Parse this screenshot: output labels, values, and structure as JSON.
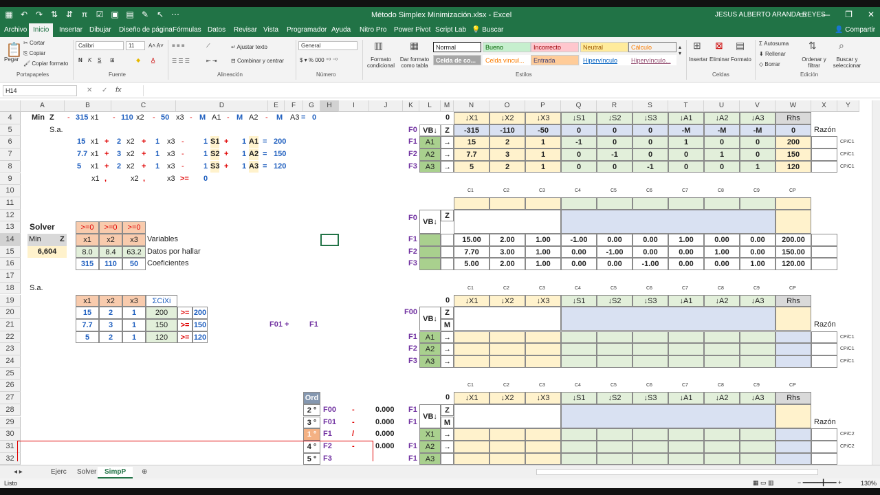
{
  "title_bar": {
    "doc_title": "Método Simplex Minimización.xlsx  -  Excel",
    "user": "JESUS ALBERTO ARANDA REYES"
  },
  "menu": [
    "Archivo",
    "Inicio",
    "Insertar",
    "Dibujar",
    "Diseño de página",
    "Fórmulas",
    "Datos",
    "Revisar",
    "Vista",
    "Programador",
    "Ayuda",
    "Nitro Pro",
    "Power Pivot",
    "Script Lab",
    "Buscar",
    "Compartir"
  ],
  "ribbon": {
    "clipboard": {
      "paste": "Pegar",
      "cut": "Cortar",
      "copy": "Copiar",
      "format_painter": "Copiar formato",
      "label": "Portapapeles"
    },
    "font": {
      "name": "Calibri",
      "size": "11",
      "label": "Fuente"
    },
    "alignment": {
      "wrap": "Ajustar texto",
      "merge": "Combinar y centrar",
      "label": "Alineación"
    },
    "number": {
      "format": "General",
      "label": "Número"
    },
    "styles": {
      "cond": "Formato condicional",
      "table": "Dar formato como tabla",
      "label": "Estilos",
      "items": [
        "Normal",
        "Bueno",
        "Incorrecto",
        "Neutral",
        "Cálculo",
        "Celda de co...",
        "Celda vincul...",
        "Entrada",
        "Hipervínculo",
        "Hipervínculo..."
      ]
    },
    "cells": {
      "insert": "Insertar",
      "delete": "Eliminar",
      "format": "Formato",
      "label": "Celdas"
    },
    "editing": {
      "autosum": "Autosuma",
      "fill": "Rellenar",
      "clear": "Borrar",
      "sort": "Ordenar y filtrar",
      "find": "Buscar y seleccionar",
      "label": "Edición"
    }
  },
  "formula_bar": {
    "name_box": "H14",
    "fx": "fx"
  },
  "columns": [
    "A",
    "B",
    "C",
    "D",
    "E",
    "F",
    "G",
    "H",
    "I",
    "J",
    "K",
    "L",
    "M",
    "N",
    "O",
    "P",
    "Q",
    "R",
    "S",
    "T",
    "U",
    "V",
    "W",
    "X",
    "Y"
  ],
  "rows": [
    "4",
    "5",
    "6",
    "7",
    "8",
    "9",
    "10",
    "11",
    "12",
    "13",
    "14",
    "15",
    "16",
    "17",
    "18",
    "19",
    "20",
    "21",
    "22",
    "23",
    "24",
    "25",
    "26",
    "27",
    "28",
    "29",
    "30",
    "31",
    "32"
  ],
  "model": {
    "min": "Min",
    "z": "Z",
    "sa": "S.a.",
    "sa2": "S.a.",
    "obj": [
      "-",
      "315",
      "x1",
      "-",
      "110",
      "x2",
      "-",
      "50",
      "x3",
      "-",
      "M",
      "A1",
      "-",
      "M",
      "A2",
      "-",
      "M",
      "A3",
      "=",
      "0"
    ],
    "c1": [
      "15",
      "x1",
      "+",
      "2",
      "x2",
      "+",
      "1",
      "x3",
      "-",
      "1",
      "S1",
      "+",
      "1",
      "A1",
      "=",
      "200"
    ],
    "c2": [
      "7.7",
      "x1",
      "+",
      "3",
      "x2",
      "+",
      "1",
      "x3",
      "-",
      "1",
      "S2",
      "+",
      "1",
      "A2",
      "=",
      "150"
    ],
    "c3": [
      "5",
      "x1",
      "+",
      "2",
      "x2",
      "+",
      "1",
      "x3",
      "-",
      "1",
      "S3",
      "+",
      "1",
      "A3",
      "=",
      "120"
    ],
    "nn": [
      "x1",
      ",",
      "x2",
      ",",
      "x3",
      ">=",
      "0"
    ]
  },
  "solver": {
    "title": "Solver",
    "min": "Min",
    "z": "Z",
    "value": "6,604",
    "ge": [
      ">=0",
      ">=0",
      ">=0"
    ],
    "vars": [
      "x1",
      "x2",
      "x3"
    ],
    "vals": [
      "8.0",
      "8.4",
      "63.2"
    ],
    "coef": [
      "315",
      "110",
      "50"
    ],
    "labels": [
      "Variables",
      "Datos por hallar",
      "Coeficientes"
    ]
  },
  "constraints_table": {
    "header": [
      "x1",
      "x2",
      "x3",
      "ΣCiXi"
    ],
    "rows": [
      [
        "15",
        "2",
        "1",
        "200",
        ">=",
        "200"
      ],
      [
        "7.7",
        "3",
        "1",
        "150",
        ">=",
        "150"
      ],
      [
        "5",
        "2",
        "1",
        "120",
        ">=",
        "120"
      ]
    ]
  },
  "f01": {
    "a": "F01 +",
    "b": "F1"
  },
  "tableau1": {
    "zero": "0",
    "headers": [
      "↓X1",
      "↓X2",
      "↓X3",
      "↓S1",
      "↓S2",
      "↓S3",
      "↓A1",
      "↓A2",
      "↓A3",
      "Rhs"
    ],
    "razon": "Razón",
    "f0": [
      "F0",
      "VB↓",
      "Z",
      "-315",
      "-110",
      "-50",
      "0",
      "0",
      "0",
      "-M",
      "-M",
      "-M",
      "0"
    ],
    "rows": [
      [
        "F1",
        "A1",
        "→",
        "15",
        "2",
        "1",
        "-1",
        "0",
        "0",
        "1",
        "0",
        "0",
        "200",
        "CP/C1"
      ],
      [
        "F2",
        "A2",
        "→",
        "7.7",
        "3",
        "1",
        "0",
        "-1",
        "0",
        "0",
        "1",
        "0",
        "150",
        "CP/C1"
      ],
      [
        "F3",
        "A3",
        "→",
        "5",
        "2",
        "1",
        "0",
        "0",
        "-1",
        "0",
        "0",
        "1",
        "120",
        "CP/C1"
      ]
    ]
  },
  "ccols": [
    "C1",
    "C2",
    "C3",
    "C4",
    "C5",
    "C6",
    "C7",
    "C8",
    "C9",
    "CP"
  ],
  "tableau2": {
    "f0": "F0",
    "vb": "VB↓",
    "z": "Z",
    "rows": [
      [
        "F1",
        "15.00",
        "2.00",
        "1.00",
        "-1.00",
        "0.00",
        "0.00",
        "1.00",
        "0.00",
        "0.00",
        "200.00"
      ],
      [
        "F2",
        "7.70",
        "3.00",
        "1.00",
        "0.00",
        "-1.00",
        "0.00",
        "0.00",
        "1.00",
        "0.00",
        "150.00"
      ],
      [
        "F3",
        "5.00",
        "2.00",
        "1.00",
        "0.00",
        "0.00",
        "-1.00",
        "0.00",
        "0.00",
        "1.00",
        "120.00"
      ]
    ]
  },
  "tableau3": {
    "zero": "0",
    "f00": "F00",
    "vb": "VB↓",
    "z": "Z",
    "m": "M",
    "razon": "Razón",
    "rows": [
      [
        "F1",
        "A1",
        "→",
        "CP/C1"
      ],
      [
        "F2",
        "A2",
        "→",
        "CP/C1"
      ],
      [
        "F3",
        "A3",
        "→",
        "CP/C1"
      ]
    ]
  },
  "tableau4": {
    "zero": "0",
    "vb": "VB↓",
    "z": "Z",
    "m": "M",
    "razon": "Razón",
    "f1a": "F1",
    "f1b": "F1",
    "rows": [
      [
        "",
        "X1",
        "→",
        "CP/C2"
      ],
      [
        "F1",
        "A2",
        "→",
        "CP/C2"
      ],
      [
        "F1",
        "A3",
        "",
        ""
      ]
    ]
  },
  "ord": {
    "header": "Ord",
    "rows": [
      [
        "2 °",
        "F00",
        "-",
        "0.000"
      ],
      [
        "3 °",
        "F01",
        "-",
        "0.000"
      ],
      [
        "1 °",
        "F1",
        "/",
        "0.000"
      ],
      [
        "4 °",
        "F2",
        "-",
        "0.000"
      ],
      [
        "5 °",
        "F3",
        "",
        ""
      ]
    ]
  },
  "sheets": [
    "Ejerc",
    "Solver",
    "SimpP"
  ],
  "status": {
    "ready": "Listo",
    "zoom": "130%"
  }
}
